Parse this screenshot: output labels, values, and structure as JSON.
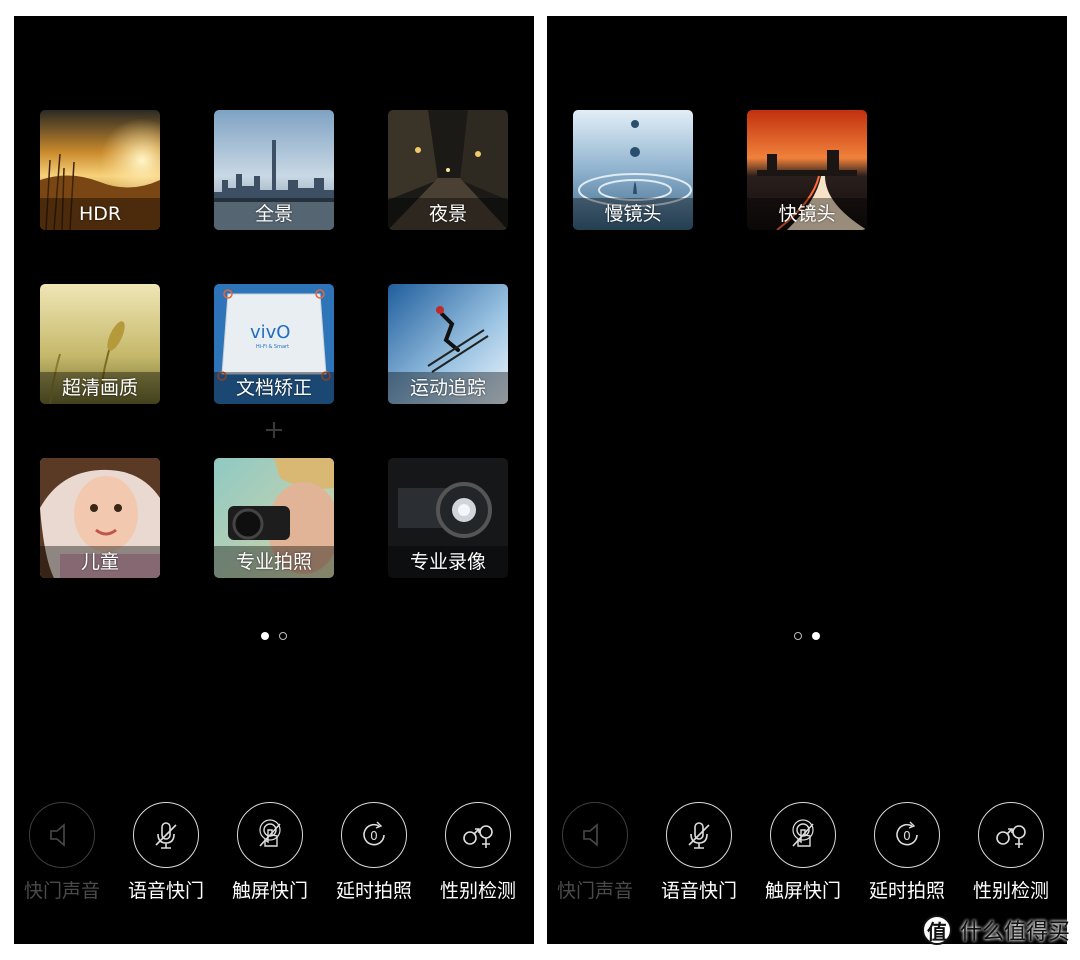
{
  "left_screen": {
    "modes": [
      {
        "label": "HDR",
        "art": "sunset-field"
      },
      {
        "label": "全景",
        "art": "city-skyline"
      },
      {
        "label": "夜景",
        "art": "night-street"
      },
      {
        "label": "超清画质",
        "art": "wheat-closeup"
      },
      {
        "label": "文档矫正",
        "art": "document-vivo"
      },
      {
        "label": "运动追踪",
        "art": "skier"
      },
      {
        "label": "儿童",
        "art": "child-portrait"
      },
      {
        "label": "专业拍照",
        "art": "camera-photographer"
      },
      {
        "label": "专业录像",
        "art": "video-camera"
      }
    ],
    "document_tile_text": {
      "brand": "vivO",
      "tagline": "Hi-Fi & Smart"
    },
    "page_dots": [
      true,
      false
    ]
  },
  "right_screen": {
    "modes": [
      {
        "label": "慢镜头",
        "art": "water-drop"
      },
      {
        "label": "快镜头",
        "art": "city-light-trails"
      }
    ],
    "page_dots": [
      false,
      true
    ]
  },
  "toolbar": [
    {
      "label": "快门声音",
      "icon": "speaker-icon",
      "enabled": false
    },
    {
      "label": "语音快门",
      "icon": "mic-off-icon",
      "enabled": true
    },
    {
      "label": "触屏快门",
      "icon": "touch-off-icon",
      "enabled": true
    },
    {
      "label": "延时拍照",
      "icon": "timer-icon",
      "enabled": true
    },
    {
      "label": "性别检测",
      "icon": "gender-icon",
      "enabled": true
    }
  ],
  "timer_value": "0",
  "watermark": {
    "badge": "值",
    "text": "什么值得买"
  }
}
